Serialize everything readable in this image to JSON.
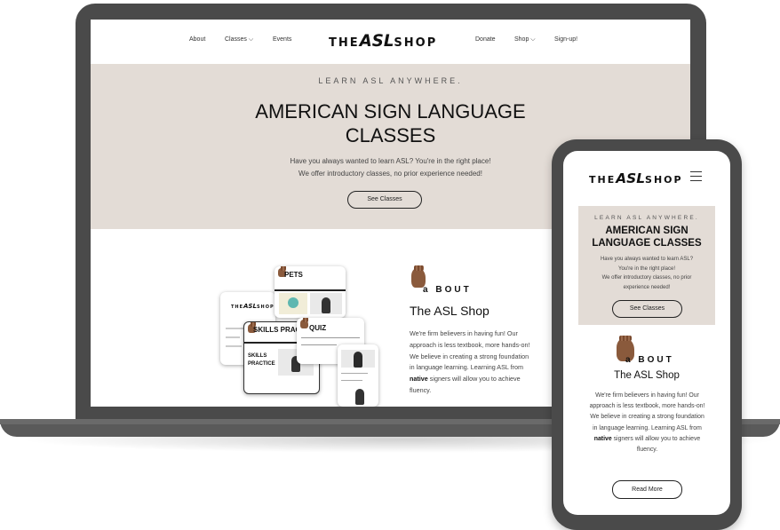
{
  "desktop": {
    "nav": {
      "about": "About",
      "classes": "Classes ⌵",
      "events": "Events",
      "donate": "Donate",
      "shop": "Shop ⌵",
      "signup": "Sign-up!"
    },
    "logo": {
      "the": "THE",
      "asl": "ASL",
      "shop": "SHOP"
    },
    "hero": {
      "eyebrow": "LEARN ASL ANYWHERE.",
      "title_line1": "AMERICAN SIGN LANGUAGE",
      "title_line2": "CLASSES",
      "sub_line1": "Have you always wanted to learn ASL? You're in the right place!",
      "sub_line2": "We offer introductory classes, no prior experience needed!",
      "button": "See Classes"
    },
    "cards": {
      "pets": "PETS",
      "skills": "SKILLS PRACTI",
      "quiz": "QUIZ",
      "skills_practice_1": "SKILLS",
      "skills_practice_2": "PRACTICE"
    },
    "about": {
      "word": "BOUT",
      "letter": "a",
      "title": "The ASL Shop",
      "text_before": "We're firm believers in having fun! Our approach is less textbook, more hands-on! We believe in creating a strong foundation in language learning. Learning ASL from ",
      "text_bold": "native",
      "text_after": " signers will allow you to achieve fluency."
    }
  },
  "mobile": {
    "logo": {
      "the": "THE",
      "asl": "ASL",
      "shop": "SHOP"
    },
    "hero": {
      "eyebrow": "LEARN ASL ANYWHERE.",
      "title_line1": "AMERICAN SIGN",
      "title_line2": "LANGUAGE CLASSES",
      "sub_line1": "Have you always wanted to learn ASL?",
      "sub_line2": "You're in the right place!",
      "sub_line3": "We offer introductory classes, no prior",
      "sub_line4": "experience needed!",
      "button": "See Classes"
    },
    "about": {
      "letter": "a",
      "word": "BOUT",
      "title": "The ASL Shop",
      "text_before": "We're firm believers in having fun! Our approach is less textbook, more hands-on! We believe in creating a strong foundation in language learning. Learning ASL from ",
      "text_bold": "native",
      "text_after": " signers will allow you to achieve fluency.",
      "button": "Read More"
    }
  }
}
